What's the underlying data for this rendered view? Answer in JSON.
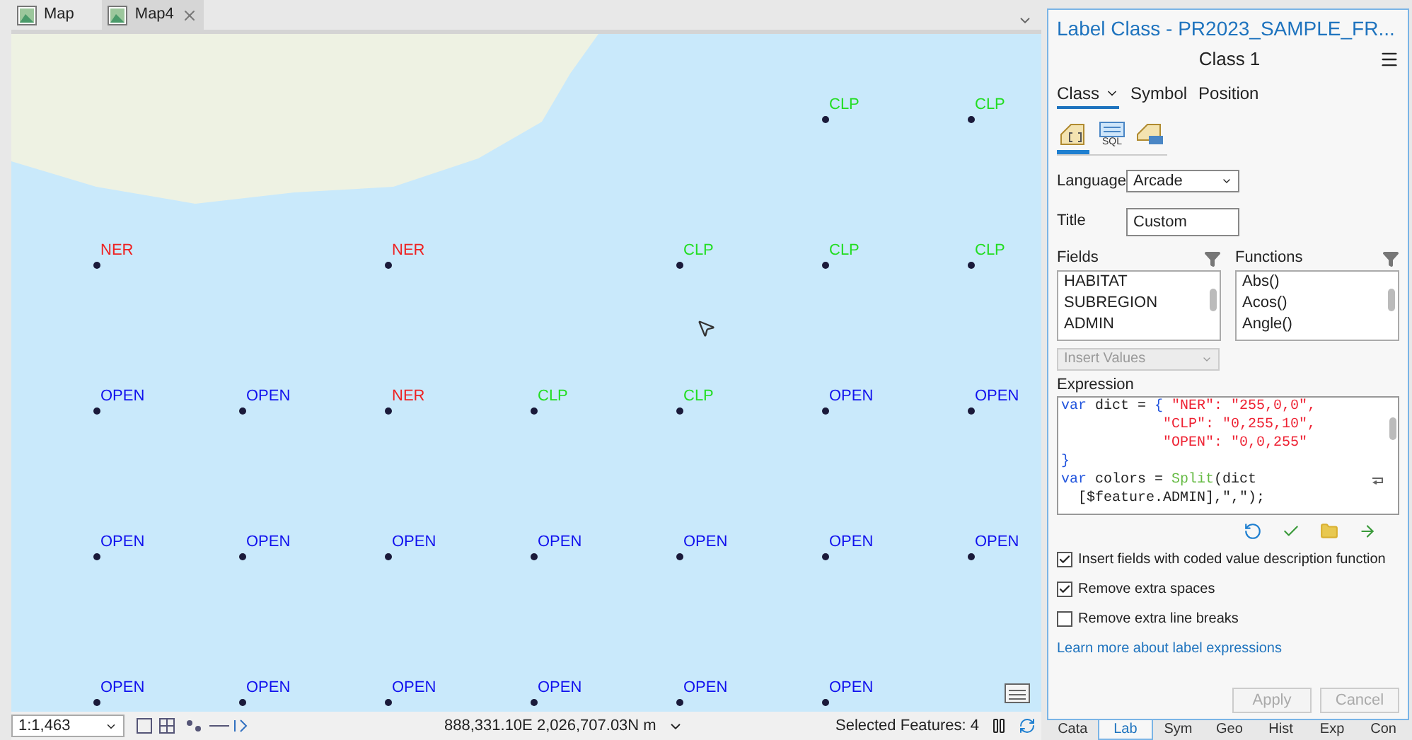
{
  "tabs": [
    {
      "label": "Map",
      "selected": false,
      "closable": false
    },
    {
      "label": "Map4",
      "selected": true,
      "closable": true
    }
  ],
  "map": {
    "rows": [
      [
        {
          "kind": "empty"
        },
        {
          "kind": "empty"
        },
        {
          "kind": "empty"
        },
        {
          "kind": "empty"
        },
        {
          "kind": "empty"
        },
        {
          "kind": "point",
          "label": "CLP",
          "color": "#22dd22"
        },
        {
          "kind": "point",
          "label": "CLP",
          "color": "#22dd22"
        }
      ],
      [
        {
          "kind": "point",
          "label": "NER",
          "color": "#ee2222"
        },
        {
          "kind": "empty"
        },
        {
          "kind": "point",
          "label": "NER",
          "color": "#ee2222"
        },
        {
          "kind": "empty"
        },
        {
          "kind": "point",
          "label": "CLP",
          "color": "#22dd22"
        },
        {
          "kind": "point",
          "label": "CLP",
          "color": "#22dd22"
        },
        {
          "kind": "point",
          "label": "CLP",
          "color": "#22dd22"
        }
      ],
      [
        {
          "kind": "point",
          "label": "OPEN",
          "color": "#1111ee"
        },
        {
          "kind": "point",
          "label": "OPEN",
          "color": "#1111ee"
        },
        {
          "kind": "point",
          "label": "NER",
          "color": "#ee2222"
        },
        {
          "kind": "point",
          "label": "CLP",
          "color": "#22dd22"
        },
        {
          "kind": "point",
          "label": "CLP",
          "color": "#22dd22"
        },
        {
          "kind": "point",
          "label": "OPEN",
          "color": "#1111ee"
        },
        {
          "kind": "point",
          "label": "OPEN",
          "color": "#1111ee"
        }
      ],
      [
        {
          "kind": "point",
          "label": "OPEN",
          "color": "#1111ee"
        },
        {
          "kind": "point",
          "label": "OPEN",
          "color": "#1111ee"
        },
        {
          "kind": "point",
          "label": "OPEN",
          "color": "#1111ee"
        },
        {
          "kind": "point",
          "label": "OPEN",
          "color": "#1111ee"
        },
        {
          "kind": "point",
          "label": "OPEN",
          "color": "#1111ee"
        },
        {
          "kind": "point",
          "label": "OPEN",
          "color": "#1111ee"
        },
        {
          "kind": "point",
          "label": "OPEN",
          "color": "#1111ee"
        }
      ],
      [
        {
          "kind": "point",
          "label": "OPEN",
          "color": "#1111ee"
        },
        {
          "kind": "point",
          "label": "OPEN",
          "color": "#1111ee"
        },
        {
          "kind": "point",
          "label": "OPEN",
          "color": "#1111ee"
        },
        {
          "kind": "point",
          "label": "OPEN",
          "color": "#1111ee"
        },
        {
          "kind": "point",
          "label": "OPEN",
          "color": "#1111ee"
        },
        {
          "kind": "point",
          "label": "OPEN",
          "color": "#1111ee"
        },
        {
          "kind": "empty"
        }
      ]
    ]
  },
  "status_bar": {
    "scale": "1:1,463",
    "coordinates": "888,331.10E 2,026,707.03N m",
    "selected_features": "Selected Features: 4"
  },
  "panel": {
    "title": "Label Class - PR2023_SAMPLE_FR...",
    "class_name": "Class 1",
    "tabs": [
      {
        "label": "Class",
        "selected": true,
        "dropdown": true
      },
      {
        "label": "Symbol",
        "selected": false,
        "dropdown": false
      },
      {
        "label": "Position",
        "selected": false,
        "dropdown": false
      }
    ],
    "icon_tabs": [
      {
        "kind": "expression",
        "selected": true
      },
      {
        "kind": "sql",
        "label": "SQL",
        "selected": false
      },
      {
        "kind": "attributes",
        "selected": false
      }
    ],
    "language": {
      "label": "Language",
      "value": "Arcade"
    },
    "title_field": {
      "label": "Title",
      "value": "Custom"
    },
    "fields": {
      "label": "Fields",
      "items": [
        "HABITAT",
        "SUBREGION",
        "ADMIN"
      ]
    },
    "functions": {
      "label": "Functions",
      "items": [
        "Abs()",
        "Acos()",
        "Angle()"
      ]
    },
    "insert_values": {
      "placeholder": "Insert Values",
      "disabled": true
    },
    "expression": {
      "label": "Expression",
      "lines": [
        {
          "kind": "normal",
          "wrapped": false,
          "tokens": [
            {
              "kind": "keyword",
              "text": "var"
            },
            {
              "kind": "plain",
              "text": " dict = "
            },
            {
              "kind": "keyword",
              "text": "{ "
            },
            {
              "kind": "string",
              "text": "\"NER\": \"255,0,0\","
            }
          ]
        },
        {
          "kind": "aligned",
          "wrapped": false,
          "tokens": [
            {
              "kind": "string",
              "text": "\"CLP\": \"0,255,10\","
            }
          ]
        },
        {
          "kind": "aligned",
          "wrapped": false,
          "tokens": [
            {
              "kind": "string",
              "text": "\"OPEN\": \"0,0,255\""
            }
          ]
        },
        {
          "kind": "normal",
          "wrapped": false,
          "tokens": [
            {
              "kind": "keyword",
              "text": "}"
            }
          ]
        },
        {
          "kind": "normal",
          "wrapped": true,
          "tokens": [
            {
              "kind": "keyword",
              "text": "var"
            },
            {
              "kind": "plain",
              "text": " colors = "
            },
            {
              "kind": "function",
              "text": "Split"
            },
            {
              "kind": "plain",
              "text": "(dict"
            }
          ]
        },
        {
          "kind": "continued",
          "wrapped": false,
          "tokens": [
            {
              "kind": "plain",
              "text": "[$feature.ADMIN],\",\");"
            }
          ]
        }
      ]
    },
    "options": [
      {
        "label": "Insert fields with coded value description function",
        "checked": true
      },
      {
        "label": "Remove extra spaces",
        "checked": true
      },
      {
        "label": "Remove extra line breaks",
        "checked": false
      }
    ],
    "link": "Learn more about label expressions",
    "buttons": [
      {
        "label": "Apply",
        "disabled": true
      },
      {
        "label": "Cancel",
        "disabled": true
      }
    ],
    "bottom_tabs": [
      {
        "label": "Cata",
        "selected": false
      },
      {
        "label": "Lab",
        "selected": true
      },
      {
        "label": "Sym",
        "selected": false
      },
      {
        "label": "Geo",
        "selected": false
      },
      {
        "label": "Hist",
        "selected": false
      },
      {
        "label": "Exp",
        "selected": false
      },
      {
        "label": "Con",
        "selected": false
      }
    ]
  }
}
